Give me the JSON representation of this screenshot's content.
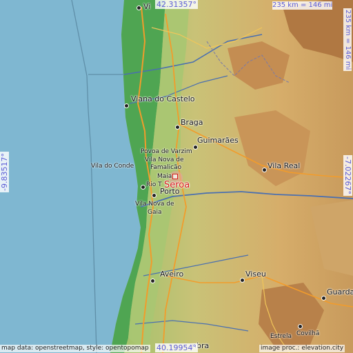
{
  "place": {
    "name": "Seroa"
  },
  "coords": {
    "north": "42.31357°",
    "south": "40.19954°",
    "west": "-9.83517°",
    "east": "-7.02267°"
  },
  "scale": {
    "top": "235 km = 146 mi",
    "right": "235 km = 146 mi"
  },
  "credits": {
    "left": "map data: openstreetmap, style: opentopomap",
    "right": "image proc.: elevation.city"
  },
  "cities": {
    "vigo_part": "Vi",
    "viana": "Viana do Castelo",
    "braga": "Braga",
    "guimaraes": "Guimarães",
    "povoa": "Povoa de Varzim",
    "vilanova_famalicao_1": "Vila Nova de",
    "vilanova_famalicao_2": "Famalicão",
    "vila_do_conde": "Vila do Conde",
    "maia": "Maia",
    "rio_tinto": "Rio T",
    "porto": "Porto",
    "gaia_1": "Vila Nova de",
    "gaia_2": "Gaia",
    "vila_real": "Vila Real",
    "aveiro": "Aveiro",
    "viseu": "Viseu",
    "guarda": "Guarda",
    "estrela": "Estrela",
    "covilha": "Covilhã",
    "coimbra_part": "nbra"
  },
  "colors": {
    "sea": "#7fb7d1",
    "coastal_plain": "#3f9a4a",
    "lowland": "#b6c77a",
    "upland": "#d8b36e",
    "mountain": "#b07842",
    "marker": "#d81b1b",
    "coord_text": "#5b5bd6"
  }
}
